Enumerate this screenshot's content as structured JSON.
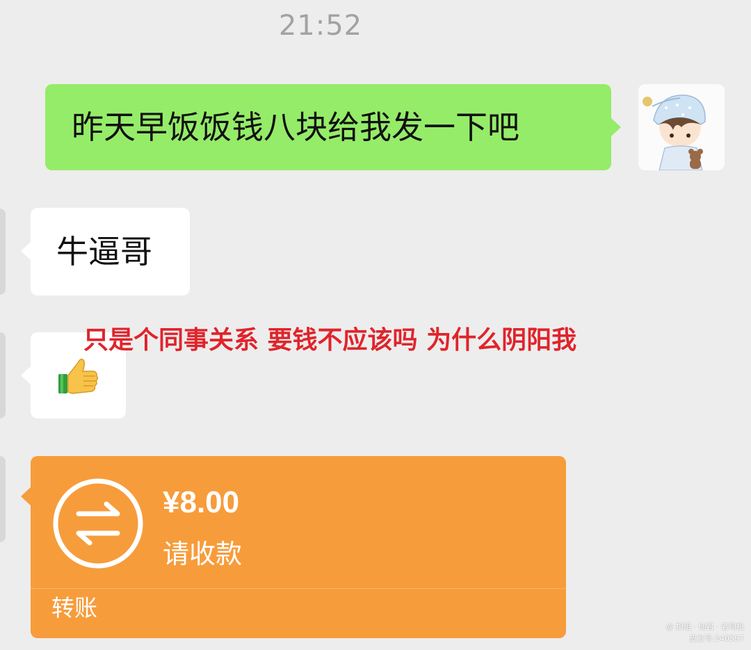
{
  "status": {
    "time": "21:52"
  },
  "messages": [
    {
      "side": "out",
      "text": "昨天早饭饭钱八块给我发一下吧"
    },
    {
      "side": "in",
      "text": "牛逼哥"
    },
    {
      "side": "in",
      "emoji": "thumbs-up-icon"
    }
  ],
  "annotation": "只是个同事关系 要钱不应该吗 为什么阴阳我",
  "transfer": {
    "amount": "¥8.00",
    "status": "请收款",
    "label": "转账",
    "icon": "transfer-arrows-icon",
    "color": "#f79c3b"
  },
  "watermark": {
    "line1": "@ 扣组 · 仙君 · 者司机",
    "line2": "皮友号:240557"
  },
  "colors": {
    "background": "#ededed",
    "out_bubble": "#95ec69",
    "in_bubble": "#ffffff",
    "annotation": "#e0242b"
  }
}
